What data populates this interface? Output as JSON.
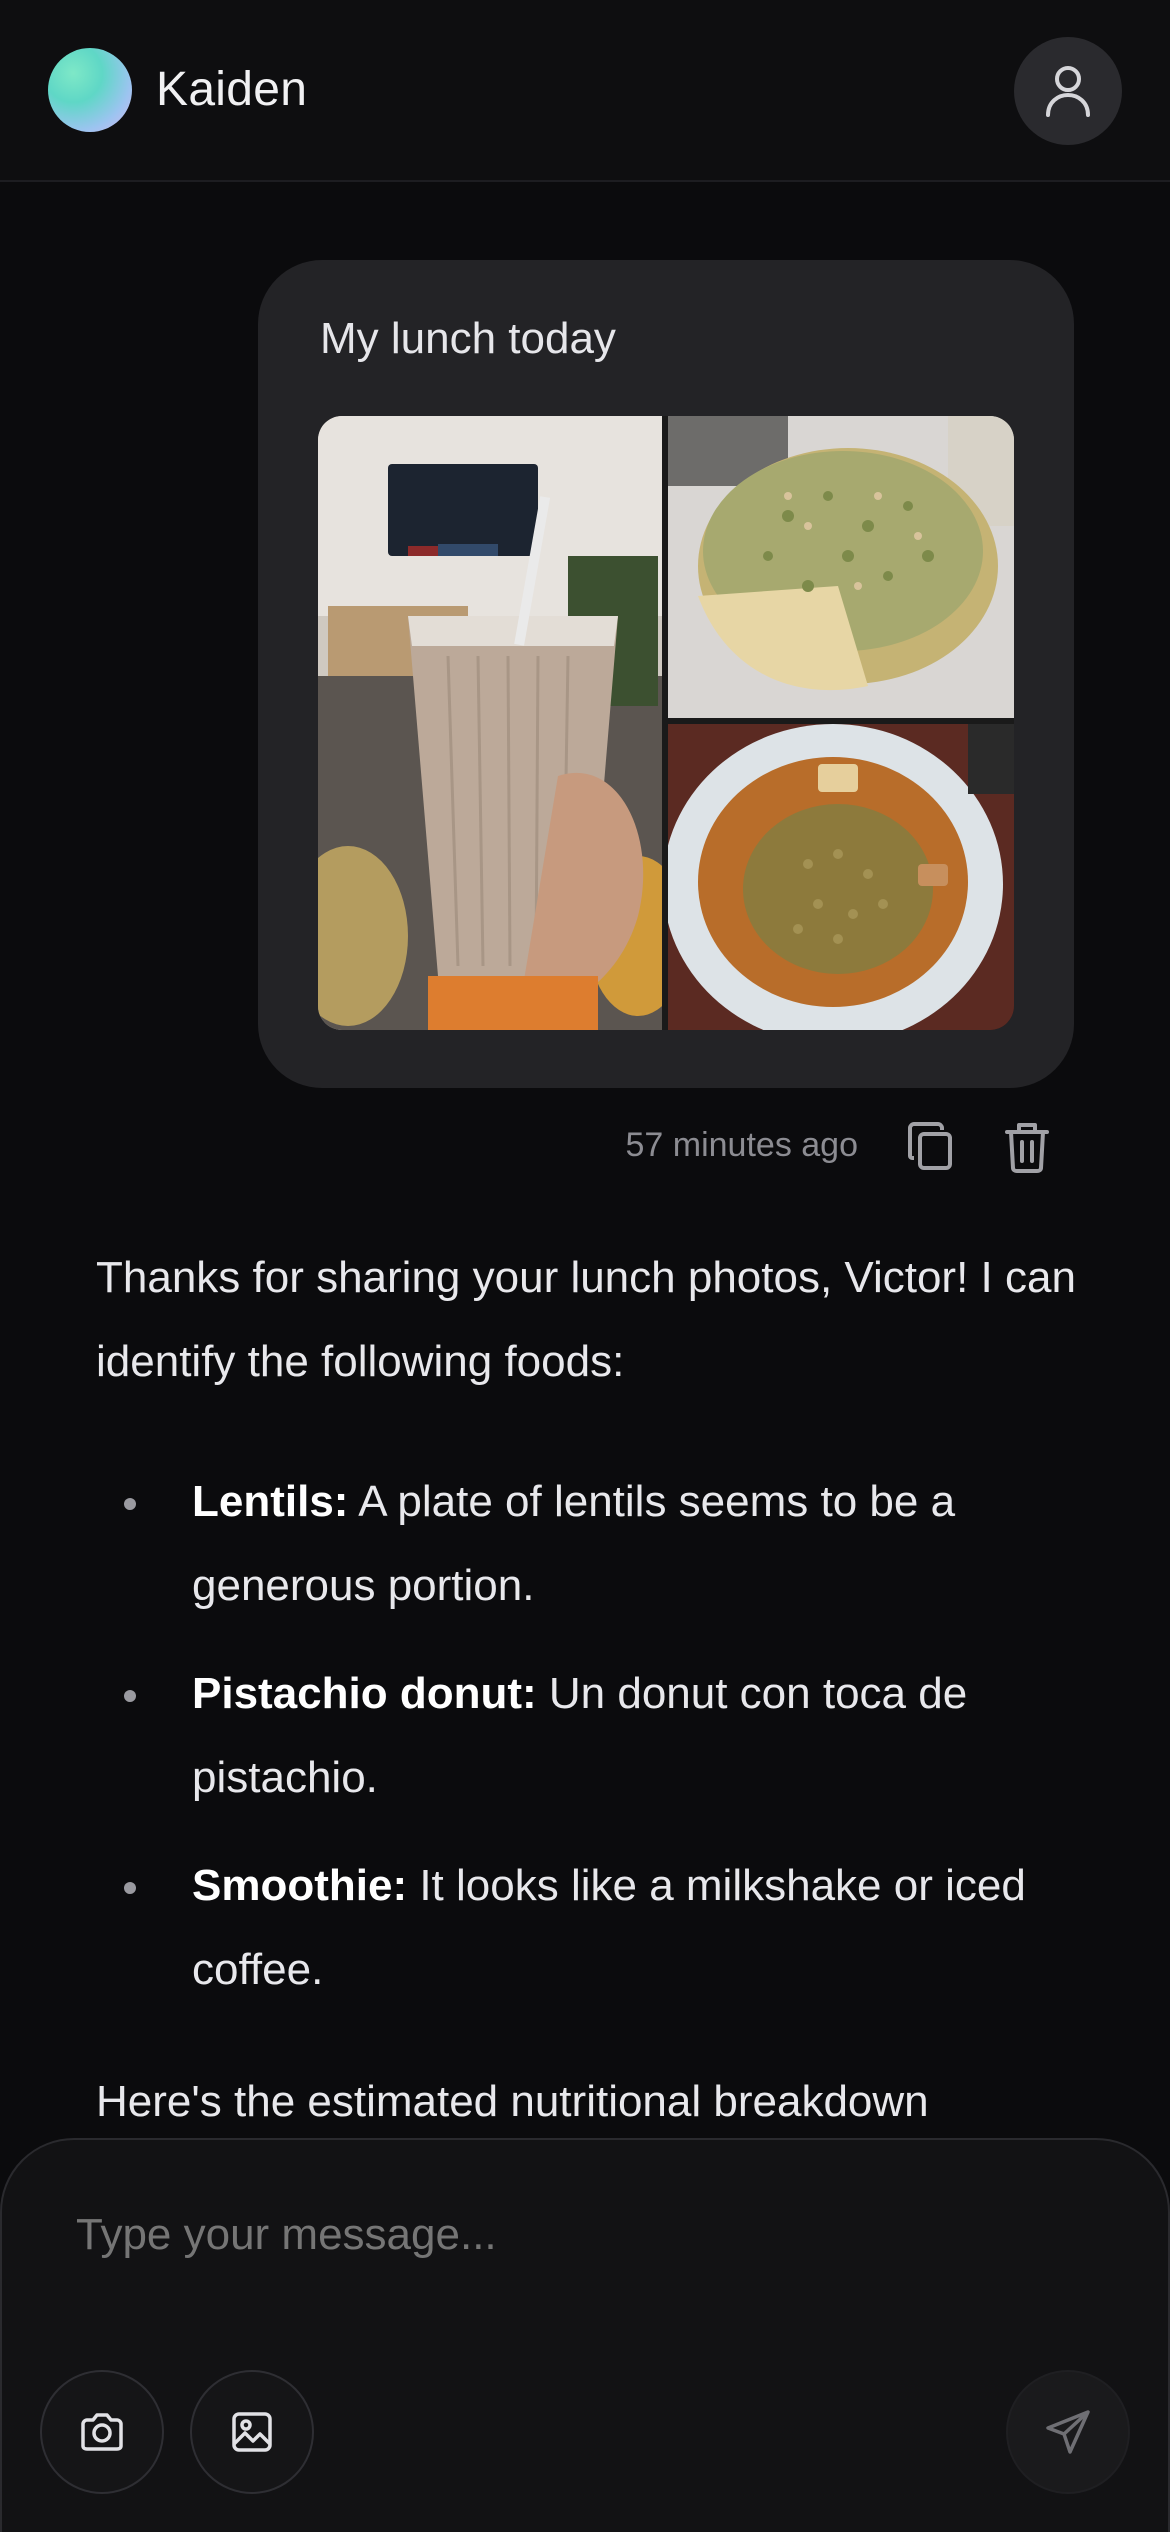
{
  "header": {
    "name": "Kaiden",
    "icons": {
      "avatar": "gradient-avatar",
      "profile": "user-icon"
    }
  },
  "user_message": {
    "text": "My lunch today",
    "images": [
      "iced-coffee-photo",
      "pistachio-donut-photo",
      "lentils-photo"
    ],
    "timestamp": "57 minutes ago",
    "actions": {
      "copy": "copy-icon",
      "delete": "trash-icon"
    }
  },
  "assistant_message": {
    "intro": "Thanks for sharing your lunch photos, Victor! I can identify the following foods:",
    "items": [
      {
        "label": "Lentils:",
        "text": " A plate of lentils seems to be a generous portion."
      },
      {
        "label": "Pistachio donut:",
        "text": " Un donut con toca de pistachio."
      },
      {
        "label": "Smoothie:",
        "text": " It looks like a milkshake or iced coffee."
      }
    ],
    "tail": "Here's the estimated nutritional breakdown"
  },
  "composer": {
    "placeholder": "Type your message...",
    "icons": {
      "camera": "camera-icon",
      "gallery": "image-icon",
      "send": "send-icon"
    }
  },
  "colors": {
    "background": "#0b0b0d",
    "bubble": "#232326",
    "text": "#e8e8ec",
    "muted": "#8c8c92"
  }
}
